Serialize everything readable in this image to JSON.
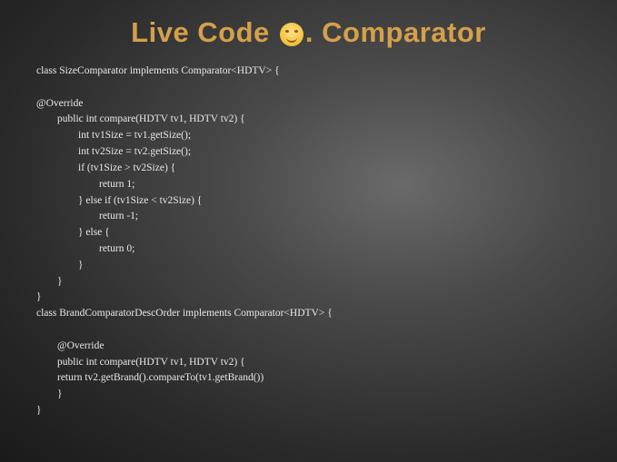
{
  "title": {
    "part1": "Live Code ",
    "part2": ". Comparator"
  },
  "code": "class SizeComparator implements Comparator<HDTV> {\n\n@Override\n        public int compare(HDTV tv1, HDTV tv2) {\n                int tv1Size = tv1.getSize();\n                int tv2Size = tv2.getSize();\n                if (tv1Size > tv2Size) {\n                        return 1;\n                } else if (tv1Size < tv2Size) {\n                        return -1;\n                } else {\n                        return 0;\n                }\n        }\n}\nclass BrandComparatorDescOrder implements Comparator<HDTV> {\n\n        @Override\n        public int compare(HDTV tv1, HDTV tv2) {\n        return tv2.getBrand().compareTo(tv1.getBrand())\n        }\n}"
}
